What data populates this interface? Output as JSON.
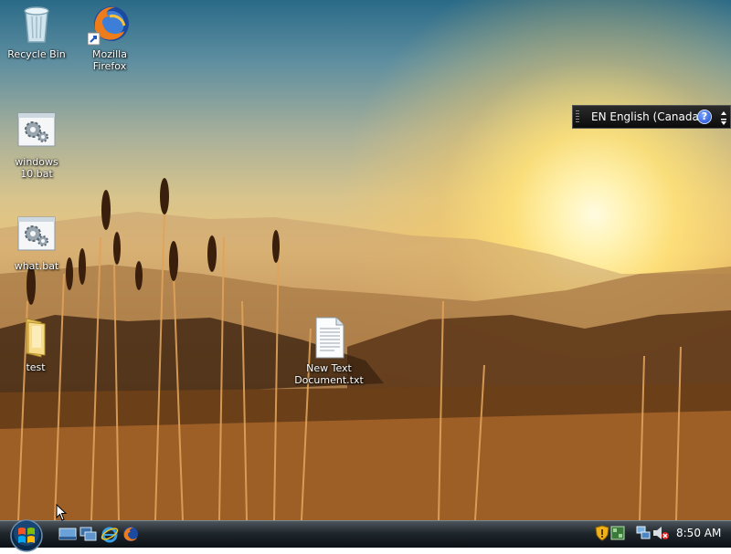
{
  "desktop": {
    "icons": [
      {
        "label": "Recycle Bin",
        "icon": "recycle-bin-icon"
      },
      {
        "label": "Mozilla Firefox",
        "icon": "firefox-icon"
      },
      {
        "label": "windows 10.bat",
        "icon": "batch-file-icon"
      },
      {
        "label": "what.bat",
        "icon": "batch-file-icon"
      },
      {
        "label": "test",
        "icon": "folder-icon"
      },
      {
        "label": "New Text Document.txt",
        "icon": "text-file-icon"
      }
    ]
  },
  "language_bar": {
    "text": "EN English (Canada)",
    "help": "?"
  },
  "taskbar": {
    "quick_launch": [
      "show-desktop-icon",
      "switch-windows-icon",
      "internet-explorer-icon",
      "firefox-icon"
    ],
    "tray": [
      "security-shield-icon",
      "network-icon",
      "connection-icon",
      "volume-muted-icon"
    ],
    "clock": "8:50 AM"
  },
  "colors": {
    "taskbar": "#20272c",
    "sky_top": "#2a6a88",
    "sun": "#fff2b0"
  }
}
